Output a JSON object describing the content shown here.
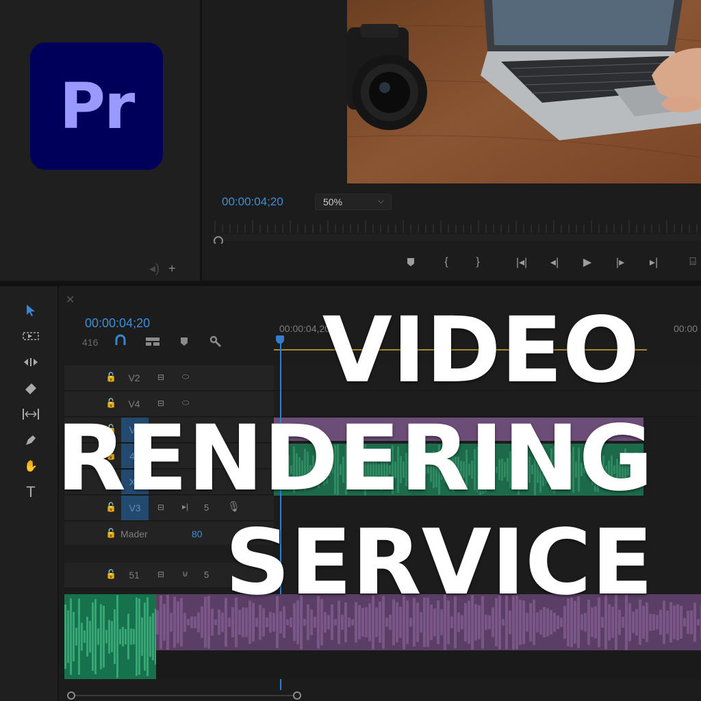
{
  "app": {
    "logo_text": "Pr"
  },
  "program_monitor": {
    "timecode": "00:00:04;20",
    "zoom": "50%"
  },
  "project_panel": {
    "foot_icons": [
      "speaker-icon",
      "plus-icon"
    ]
  },
  "tools": [
    {
      "name": "selection-tool-icon"
    },
    {
      "name": "track-select-tool-icon"
    },
    {
      "name": "ripple-edit-tool-icon"
    },
    {
      "name": "razor-tool-icon"
    },
    {
      "name": "slip-tool-icon"
    },
    {
      "name": "pen-tool-icon"
    },
    {
      "name": "hand-tool-icon"
    },
    {
      "name": "type-tool-icon"
    }
  ],
  "timeline": {
    "timecode": "00:00:04;20",
    "counter": "416",
    "ruler_start": "00:00:04,20",
    "ruler_end": "00:00",
    "tracks": [
      {
        "name": "V2",
        "selected": false,
        "icons": [
          "film-icon",
          "eye-icon"
        ]
      },
      {
        "name": "V4",
        "selected": false,
        "icons": [
          "film-icon",
          "eye-icon"
        ]
      },
      {
        "name": "V2",
        "selected": true,
        "icons": []
      },
      {
        "name": "41",
        "selected": true,
        "icons": []
      },
      {
        "name": "X3",
        "selected": true,
        "icons": []
      },
      {
        "name": "V3",
        "selected": true,
        "icons": [
          "film-icon",
          "mute-icon",
          "solo-icon",
          "mic-icon"
        ],
        "extra": "5"
      },
      {
        "name": "Mader",
        "selected": false,
        "value": "80"
      },
      {
        "name": "51",
        "selected": false,
        "icons": [
          "film-icon",
          "mute-icon"
        ],
        "extra": "5"
      }
    ]
  },
  "headline": {
    "line1": "VIDEO",
    "line2": "RENDERING",
    "line3": "SERVICE"
  },
  "colors": {
    "accent_blue": "#3d8fd8",
    "logo_bg": "#00005b",
    "logo_text": "#9999ff",
    "clip_purple": "#6c4d78",
    "clip_green": "#1d6a4b"
  }
}
